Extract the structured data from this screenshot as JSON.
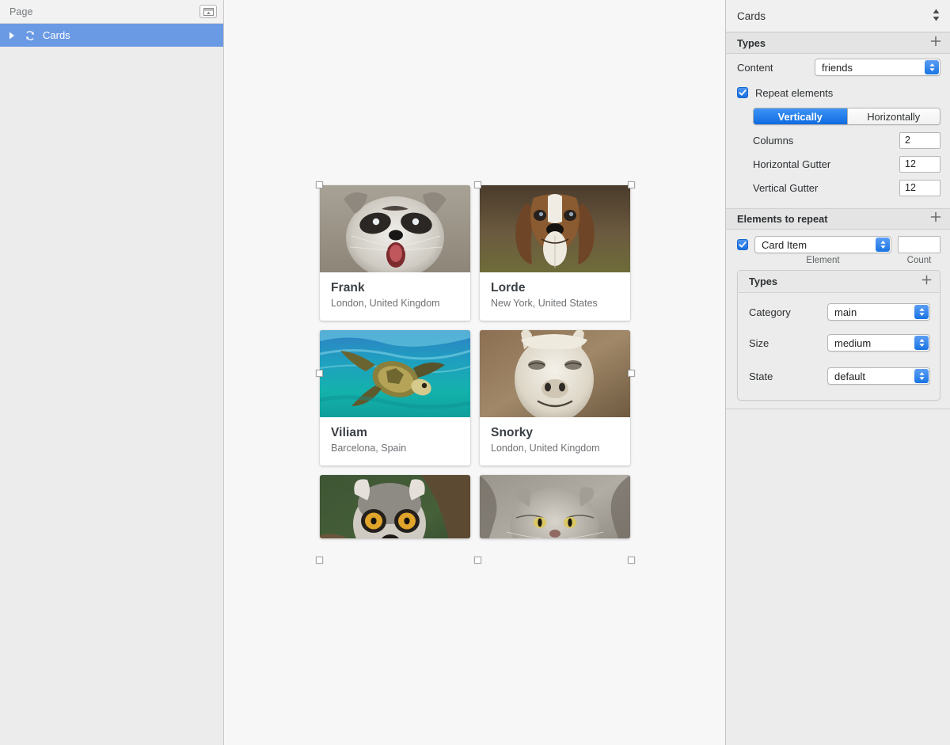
{
  "sidebar": {
    "header_title": "Page",
    "toggle_icon": "panel-toggle-icon",
    "tree": [
      {
        "label": "Cards",
        "icon": "repeat-loop-icon",
        "disclosure": "triangle-right-icon",
        "selected": true
      }
    ]
  },
  "canvas": {
    "cards": [
      {
        "name": "Frank",
        "location": "London, United Kingdom",
        "photo": "raccoon-photo"
      },
      {
        "name": "Lorde",
        "location": "New York, United States",
        "photo": "beagle-dog-photo"
      },
      {
        "name": "Viliam",
        "location": "Barcelona, Spain",
        "photo": "sea-turtle-photo"
      },
      {
        "name": "Snorky",
        "location": "London, United Kingdom",
        "photo": "llama-photo"
      },
      {
        "name": "",
        "location": "",
        "photo": "lemur-photo"
      },
      {
        "name": "",
        "location": "",
        "photo": "manul-cat-photo"
      }
    ]
  },
  "inspector": {
    "title": "Cards",
    "title_stepper_icon": "stepper-up-down-icon",
    "types_section": {
      "header": "Types",
      "add_icon": "plus-icon",
      "content_label": "Content",
      "content_value": "friends",
      "repeat_elements_label": "Repeat elements",
      "repeat_elements_checked": true,
      "direction_options": [
        "Vertically",
        "Horizontally"
      ],
      "direction_selected": "Vertically",
      "columns_label": "Columns",
      "columns_value": "2",
      "horizontal_gutter_label": "Horizontal Gutter",
      "horizontal_gutter_value": "12",
      "vertical_gutter_label": "Vertical Gutter",
      "vertical_gutter_value": "12"
    },
    "elements_section": {
      "header": "Elements to repeat",
      "add_icon": "plus-icon",
      "item_checked": true,
      "element_value": "Card Item",
      "element_caption": "Element",
      "count_value": "",
      "count_caption": "Count",
      "nested_types": {
        "header": "Types",
        "add_icon": "plus-icon",
        "rows": [
          {
            "label": "Category",
            "value": "main"
          },
          {
            "label": "Size",
            "value": "medium"
          },
          {
            "label": "State",
            "value": "default"
          }
        ]
      }
    }
  },
  "colors": {
    "accent_blue": "#1a74e2",
    "selection_blue": "#6b9ae4",
    "panel_bg": "#ececec",
    "canvas_bg": "#f7f7f7"
  }
}
